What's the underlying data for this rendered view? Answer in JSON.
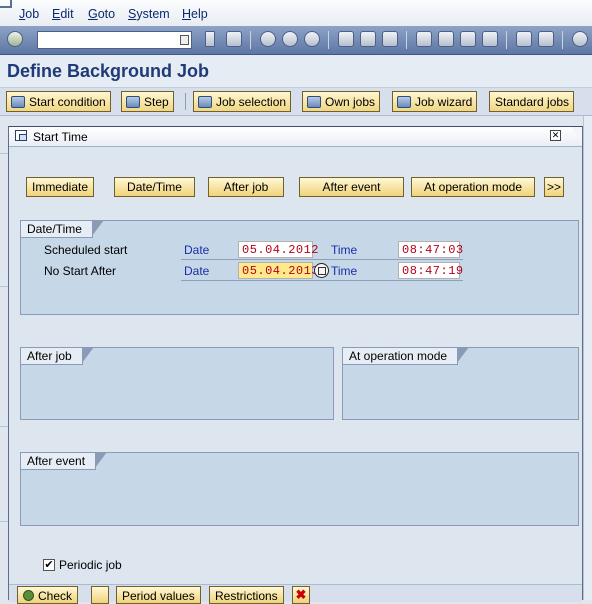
{
  "menu": {
    "items": [
      "Job",
      "Edit",
      "Goto",
      "System",
      "Help"
    ]
  },
  "system_toolbar": {
    "command_field_value": ""
  },
  "page": {
    "title": "Define Background Job"
  },
  "app_toolbar": {
    "buttons": [
      "Start condition",
      "Step",
      "Job selection",
      "Own jobs",
      "Job wizard",
      "Standard jobs"
    ]
  },
  "dialog": {
    "title": "Start Time",
    "type_buttons": [
      "Immediate",
      "Date/Time",
      "After job",
      "After event",
      "At operation mode",
      ">>"
    ],
    "datetime_group": {
      "title": "Date/Time",
      "rows": [
        {
          "label": "Scheduled start",
          "date_label": "Date",
          "date": "05.04.2012",
          "time_label": "Time",
          "time": "08:47:03"
        },
        {
          "label": "No Start After",
          "date_label": "Date",
          "date": "05.04.2013",
          "time_label": "Time",
          "time": "08:47:19"
        }
      ]
    },
    "after_job_group": {
      "title": "After job"
    },
    "op_mode_group": {
      "title": "At operation mode"
    },
    "after_event_group": {
      "title": "After event"
    },
    "periodic_job": {
      "label": "Periodic job",
      "checked": true
    },
    "bottom_buttons": [
      "Check",
      "Period values",
      "Restrictions"
    ]
  },
  "colors": {
    "title_blue": "#1f3a78",
    "label_blue": "#1a2fa8",
    "value_red": "#b4001c",
    "button_yellow": "#f0d37a",
    "highlight_yellow": "#ffe98a"
  }
}
